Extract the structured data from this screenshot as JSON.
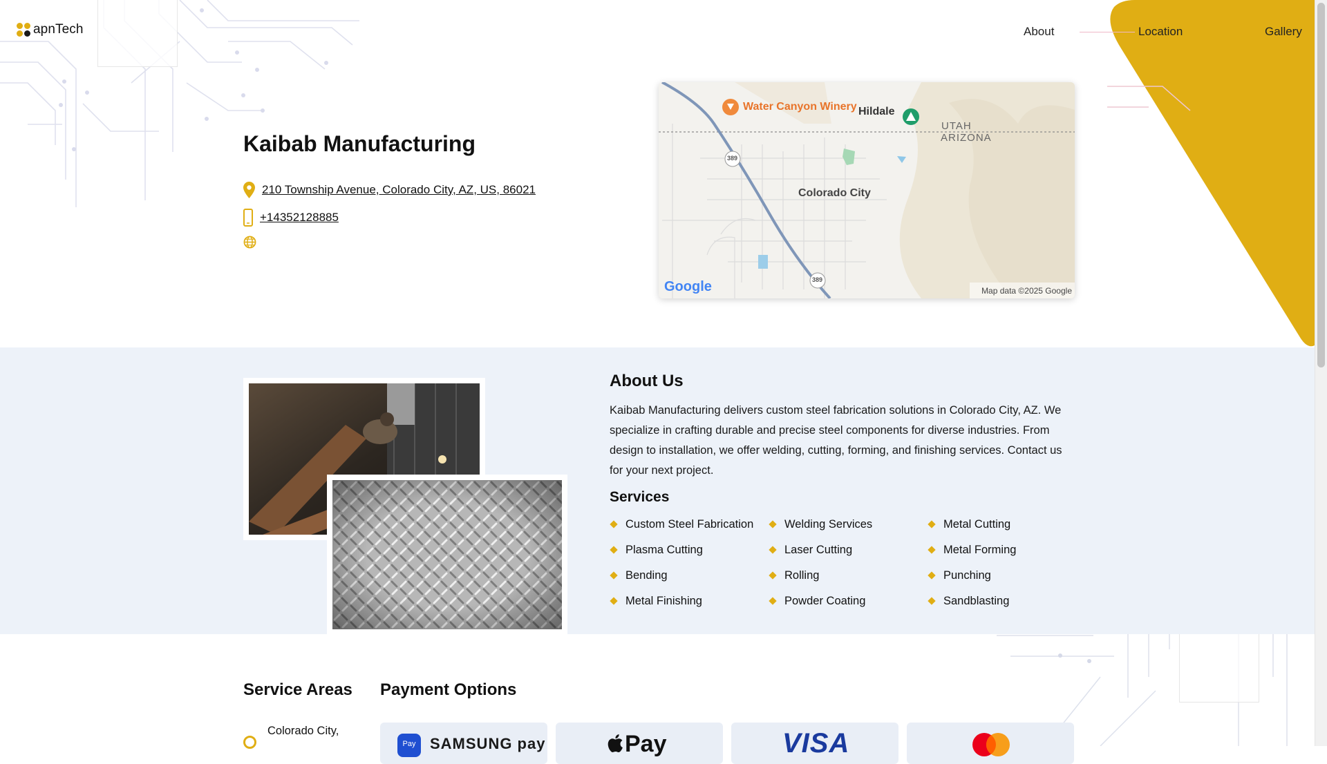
{
  "brand": {
    "logo_text": "apnTech"
  },
  "nav": {
    "about": "About",
    "location": "Location",
    "gallery": "Gallery"
  },
  "business": {
    "name": "Kaibab Manufacturing",
    "address": "210 Township Avenue, Colorado City, AZ, US, 86021",
    "phone": "+14352128885"
  },
  "map": {
    "labels": {
      "winery": "Water Canyon Winery",
      "hildale": "Hildale",
      "utah": "UTAH",
      "arizona": "ARIZONA",
      "city": "Colorado City",
      "route_top": "389",
      "route_bottom": "389",
      "provider": "Google",
      "attribution": "Map data ©2025 Google"
    }
  },
  "about": {
    "title": "About Us",
    "text": "Kaibab Manufacturing delivers custom steel fabrication solutions in Colorado City, AZ. We specialize in crafting durable and precise steel components for diverse industries. From design to installation, we offer welding, cutting, forming, and finishing services. Contact us for your next project.",
    "services_title": "Services",
    "services": [
      "Custom Steel Fabrication",
      "Welding Services",
      "Metal Cutting",
      "Plasma Cutting",
      "Laser Cutting",
      "Metal Forming",
      "Bending",
      "Rolling",
      "Punching",
      "Metal Finishing",
      "Powder Coating",
      "Sandblasting"
    ]
  },
  "service_areas": {
    "title": "Service Areas",
    "items": [
      "Colorado City,"
    ]
  },
  "payment": {
    "title": "Payment Options",
    "samsung_badge": "Pay",
    "samsung_text": "SAMSUNG pay",
    "apple_text": "Pay",
    "visa_text": "VISA"
  },
  "colors": {
    "accent": "#e0ae14",
    "band": "#edf2f9",
    "text": "#111111"
  },
  "icons": [
    "location-pin-icon",
    "phone-icon",
    "globe-icon",
    "apple-logo-icon",
    "mastercard-logo-icon"
  ]
}
